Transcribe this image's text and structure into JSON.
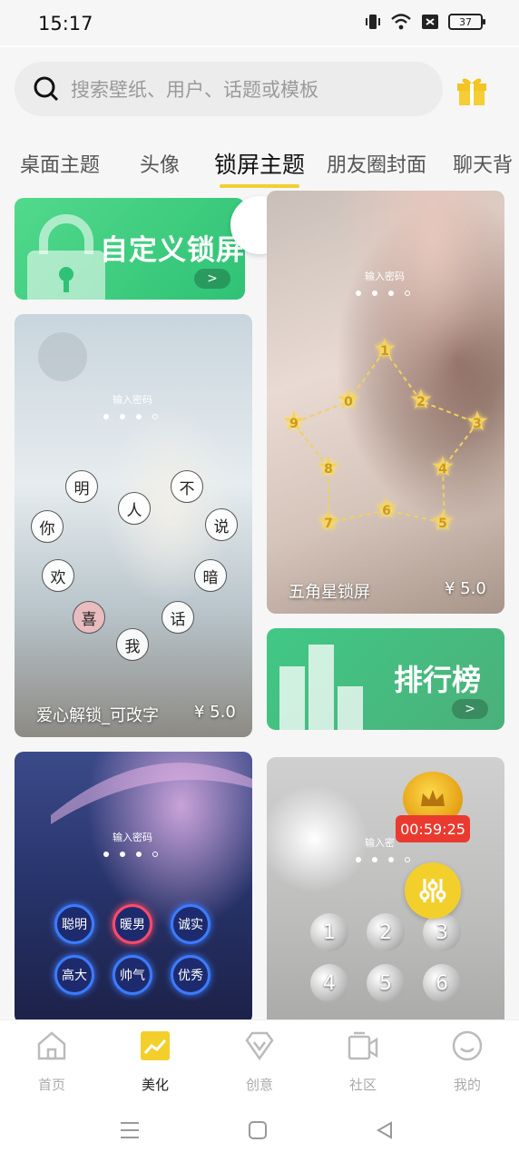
{
  "status": {
    "time": "15:17",
    "battery": "37"
  },
  "search": {
    "placeholder": "搜索壁纸、用户、话题或模板"
  },
  "tabs": [
    "桌面主题",
    "头像",
    "锁屏主题",
    "朋友圈封面",
    "聊天背"
  ],
  "active_tab_index": 2,
  "cards": {
    "custom_banner": {
      "title": "自定义锁屏",
      "arrow": ">"
    },
    "star_lock": {
      "password_label": "输入密码",
      "caption": "五角星锁屏",
      "price": "¥ 5.0",
      "stars": [
        "1",
        "2",
        "3",
        "4",
        "5",
        "6",
        "7",
        "8",
        "9",
        "0"
      ]
    },
    "heart_lock": {
      "password_label": "输入密码",
      "caption": "爱心解锁_可改字",
      "price": "¥ 5.0",
      "chars": [
        "明",
        "不",
        "人",
        "你",
        "说",
        "欢",
        "暗",
        "喜",
        "话",
        "我"
      ]
    },
    "rank_banner": {
      "title": "排行榜",
      "arrow": ">"
    },
    "neon_lock": {
      "password_label": "输入密码",
      "buttons": [
        "聪明",
        "暖男",
        "诚实",
        "高大",
        "帅气",
        "优秀"
      ]
    },
    "water_lock": {
      "password_label": "输入密",
      "timer": "00:59:25",
      "keys": [
        "1",
        "2",
        "3",
        "4",
        "5",
        "6"
      ]
    }
  },
  "bottom_nav": [
    {
      "label": "首页",
      "icon": "home-icon"
    },
    {
      "label": "美化",
      "icon": "chart-icon"
    },
    {
      "label": "创意",
      "icon": "diamond-icon"
    },
    {
      "label": "社区",
      "icon": "video-icon"
    },
    {
      "label": "我的",
      "icon": "smile-icon"
    }
  ],
  "colors": {
    "accent": "#f2cf2f",
    "green": "#2fc275",
    "timer_red": "#ea3a2f"
  }
}
